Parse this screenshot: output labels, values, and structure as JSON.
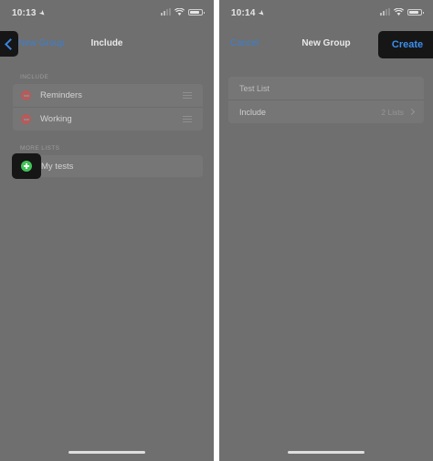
{
  "left_screen": {
    "status": {
      "time": "10:13"
    },
    "nav": {
      "back_label": "New Group",
      "title": "Include"
    },
    "include_section": {
      "header": "INCLUDE",
      "items": [
        {
          "label": "Reminders"
        },
        {
          "label": "Working"
        }
      ]
    },
    "more_section": {
      "header": "MORE LISTS",
      "items": [
        {
          "label": "My tests"
        }
      ]
    }
  },
  "right_screen": {
    "status": {
      "time": "10:14"
    },
    "nav": {
      "cancel_label": "Cancel",
      "title": "New Group",
      "create_label": "Create"
    },
    "form": {
      "name_value": "Test List",
      "include_label": "Include",
      "include_value": "2 Lists"
    }
  },
  "colors": {
    "accent_blue": "#3d8ff0",
    "remove_red": "#b85a5a",
    "add_green": "#3fc456",
    "dim_overlay": "#6f6f6f",
    "highlight": "#161616"
  },
  "icons": {
    "location": "location-arrow-icon",
    "signal": "cellular-signal-icon",
    "wifi": "wifi-icon",
    "battery": "battery-icon",
    "back": "chevron-left-icon",
    "remove": "minus-circle-icon",
    "add": "plus-circle-icon",
    "reorder": "drag-handle-icon",
    "disclosure": "chevron-right-icon"
  }
}
